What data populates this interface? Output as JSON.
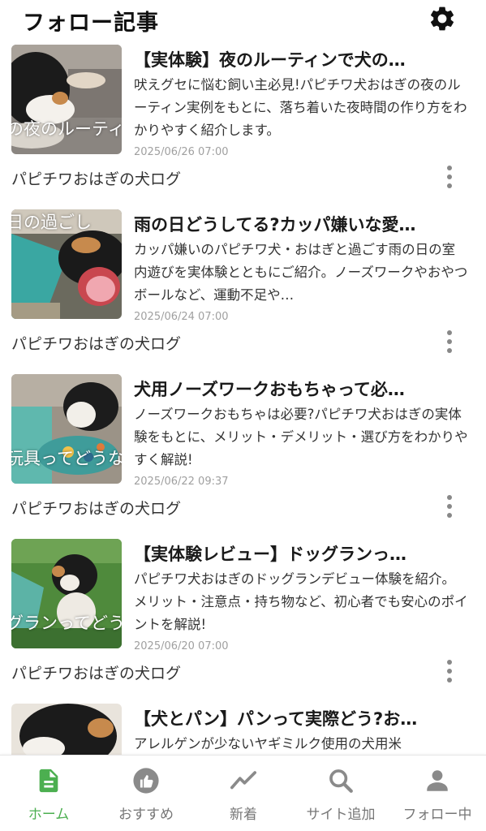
{
  "header": {
    "title": "フォロー記事",
    "settings_icon": "gear-icon"
  },
  "articles": [
    {
      "title": "【実体験】夜のルーティンで犬の…",
      "excerpt": "吠えグセに悩む飼い主必見!パピチワ犬おはぎの夜のルーティン実例をもとに、落ち着いた夜時間の作り方をわかりやすく紹介します。",
      "date": "2025/06/26 07:00",
      "site": "パピチワおはぎの犬ログ",
      "thumb_caption": "の夜のルーティ"
    },
    {
      "title": "雨の日どうしてる?カッパ嫌いな愛…",
      "excerpt": "カッパ嫌いのパピチワ犬・おはぎと過ごす雨の日の室内遊びを実体験とともにご紹介。ノーズワークやおやつボールなど、運動不足や…",
      "date": "2025/06/24 07:00",
      "site": "パピチワおはぎの犬ログ",
      "thumb_caption": "日の過ごし"
    },
    {
      "title": "犬用ノーズワークおもちゃって必…",
      "excerpt": "ノーズワークおもちゃは必要?パピチワ犬おはぎの実体験をもとに、メリット・デメリット・選び方をわかりやすく解説!",
      "date": "2025/06/22 09:37",
      "site": "パピチワおはぎの犬ログ",
      "thumb_caption": "玩具ってどうな"
    },
    {
      "title": "【実体験レビュー】ドッグランっ…",
      "excerpt": "パピチワ犬おはぎのドッグランデビュー体験を紹介。メリット・注意点・持ち物など、初心者でも安心のポイントを解説!",
      "date": "2025/06/20 07:00",
      "site": "パピチワおはぎの犬ログ",
      "thumb_caption": "グランってどうな"
    },
    {
      "title": "【犬とパン】パンって実際どう?お…",
      "excerpt": "アレルゲンが少ないヤギミルク使用の犬用米",
      "date": "",
      "site": "",
      "thumb_caption": ""
    }
  ],
  "tabs": [
    {
      "label": "ホーム",
      "icon": "document-icon",
      "active": true
    },
    {
      "label": "おすすめ",
      "icon": "thumbs-up-icon",
      "active": false
    },
    {
      "label": "新着",
      "icon": "trend-icon",
      "active": false
    },
    {
      "label": "サイト追加",
      "icon": "search-icon",
      "active": false
    },
    {
      "label": "フォロー中",
      "icon": "person-icon",
      "active": false
    }
  ],
  "colors": {
    "accent": "#4caf50",
    "inactive": "#8a8a8a"
  }
}
